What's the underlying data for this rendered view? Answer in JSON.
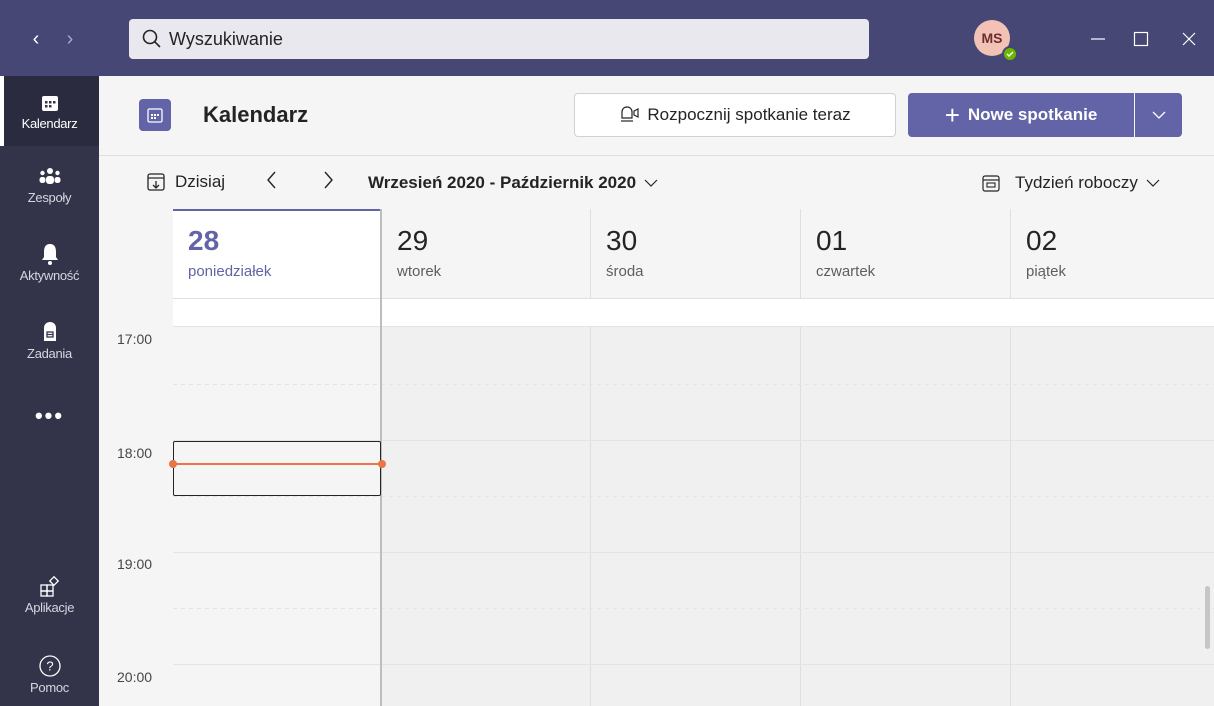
{
  "titlebar": {
    "search_placeholder": "Wyszukiwanie",
    "avatar_initials": "MS",
    "presence_status": "available",
    "accent_color": "#464775"
  },
  "rail": {
    "items": [
      {
        "label": "Kalendarz",
        "icon": "calendar-icon",
        "active": true
      },
      {
        "label": "Zespoły",
        "icon": "teams-icon"
      },
      {
        "label": "Aktywność",
        "icon": "bell-icon"
      },
      {
        "label": "Zadania",
        "icon": "tasks-icon"
      },
      {
        "label": "Aplikacje",
        "icon": "apps-icon"
      },
      {
        "label": "Pomoc",
        "icon": "help-icon"
      }
    ],
    "more": "•••"
  },
  "header": {
    "title": "Kalendarz",
    "meet_now_label": "Rozpocznij spotkanie teraz",
    "new_meeting_label": "Nowe spotkanie",
    "brand_color": "#6264a7"
  },
  "toolbar": {
    "today_label": "Dzisiaj",
    "range_label": "Wrzesień 2020 - Październik 2020",
    "view_label": "Tydzień roboczy"
  },
  "days": [
    {
      "num": "28",
      "name": "poniedziałek",
      "today": true
    },
    {
      "num": "29",
      "name": "wtorek"
    },
    {
      "num": "30",
      "name": "środa"
    },
    {
      "num": "01",
      "name": "czwartek"
    },
    {
      "num": "02",
      "name": "piątek"
    }
  ],
  "times": [
    "17:00",
    "18:00",
    "19:00",
    "20:00"
  ],
  "now_indicator_color": "#e97548"
}
